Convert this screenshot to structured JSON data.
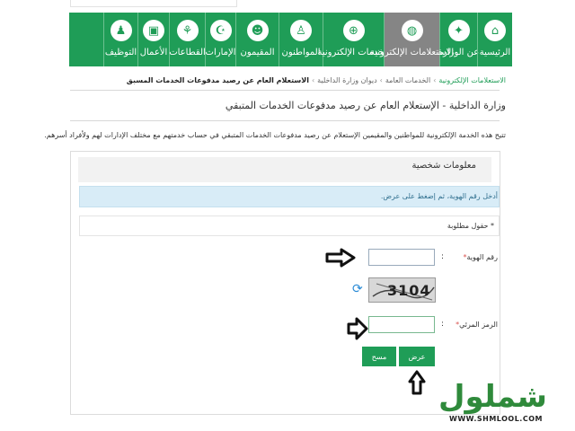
{
  "nav": {
    "items": [
      {
        "label": "الرئيسية",
        "icon": "home-icon",
        "glyph": "⌂"
      },
      {
        "label": "عن الوزارة",
        "icon": "ministry-emblem-icon",
        "glyph": "✦"
      },
      {
        "label": "الاستعلامات الإلكترونية",
        "icon": "inquiry-icon",
        "glyph": "◍"
      },
      {
        "label": "الخدمات الإلكترونية",
        "icon": "globe-icon",
        "glyph": "⊕"
      },
      {
        "label": "المواطنون",
        "icon": "citizen-icon",
        "glyph": "♙"
      },
      {
        "label": "المقيمون",
        "icon": "residents-icon",
        "glyph": "☻"
      },
      {
        "label": "الإمارات",
        "icon": "emirates-icon",
        "glyph": "☪"
      },
      {
        "label": "القطاعات",
        "icon": "sectors-icon",
        "glyph": "⚘"
      },
      {
        "label": "الأعمال",
        "icon": "briefcase-icon",
        "glyph": "▣"
      },
      {
        "label": "التوظيف",
        "icon": "employment-icon",
        "glyph": "♟"
      }
    ],
    "active_index": 2,
    "color": "#1f9d57"
  },
  "breadcrumb": {
    "first": "الاستعلامات الإلكترونية",
    "second": "الخدمات العامة",
    "third": "ديوان وزارة الداخلية",
    "last": "الاستعلام العام عن رصيد مدفوعات الخدمات المسبق",
    "separator": "›"
  },
  "page": {
    "title": "وزارة الداخلية - الإستعلام العام عن رصيد مدفوعات الخدمات المتبقي",
    "intro": "تتيح هذه الخدمة الإلكترونية للمواطنين والمقيمين الإستعلام عن رصيد مدفوعات الخدمات المتبقي في حساب خدمتهم مع مختلف الإدارات لهم ولأفراد أسرهم."
  },
  "form": {
    "section_title": "معلومات شخصية",
    "alert": "أدخل رقم الهوية، ثم إضغط على عرض.",
    "required_note": "* حقول مطلوبة",
    "id_label": "رقم الهوية",
    "captcha_label": "الرمز المرئي",
    "star": "*",
    "colon": ":",
    "captcha_text": "3104",
    "id_value": "",
    "captcha_value": "",
    "view_button": "عرض",
    "clear_button": "مسح"
  },
  "watermark": {
    "logo_text": "شملول",
    "url": "WWW.SHMLOOL.COM"
  }
}
